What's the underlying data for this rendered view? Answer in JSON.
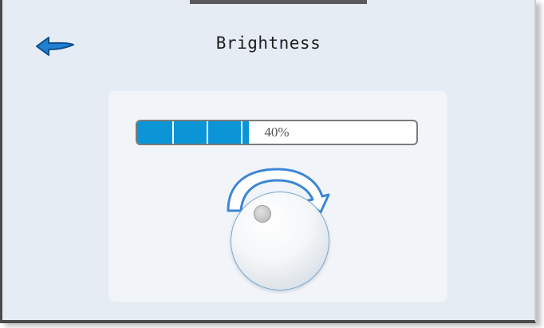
{
  "header": {
    "title": "Brightness",
    "back_icon": "arrow-left-icon"
  },
  "brightness": {
    "percent": 40,
    "label": "40%",
    "segments": 4
  },
  "knob": {
    "icon": "rotate-clockwise-icon"
  },
  "colors": {
    "background": "#e6ecf3",
    "panel": "#f1f5f9",
    "accent": "#0b95d6",
    "arrow": "#1f7fd0"
  }
}
